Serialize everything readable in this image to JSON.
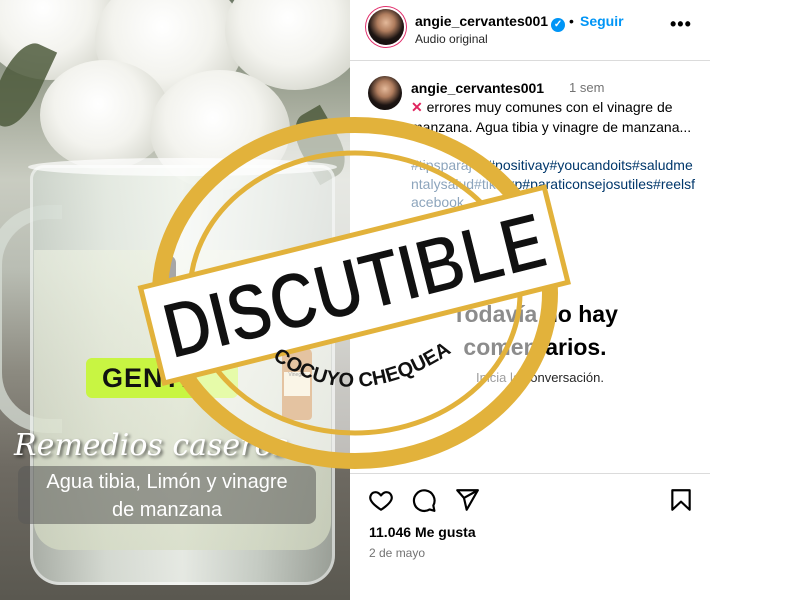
{
  "post": {
    "username": "angie_cervantes001",
    "verified_mark": "✓",
    "follow_label": "Seguir",
    "separator": "•",
    "audio_label": "Audio original",
    "more_label": "•••",
    "caption_time": "1 sem",
    "caption_mark": "✕",
    "caption_text": "errores muy comunes con el vinagre de manzana. Agua tibia y vinagre de manzana...",
    "hashtags": "#tipsparajep#positivay#youcandoits#saludmentalysalud#tiktokp#paraticonsejosutiles#reelsfacebook",
    "no_comments": "Todavía no hay comentarios.",
    "start_conversation": "Inicia la conversación.",
    "likes": "11.046 Me gusta",
    "date": "2 de mayo"
  },
  "media": {
    "tag": "GENTE",
    "title": "Remedios caseros",
    "ingredients_line1": "Agua tibia, Limón y vinagre",
    "ingredients_line2": "de manzana",
    "vinegar_label": "Vinegar"
  },
  "stamp": {
    "verdict": "DISCUTIBLE",
    "brand": "COCUYO CHEQUEA"
  },
  "icons": {
    "like": "heart-icon",
    "comment": "comment-icon",
    "share": "share-icon",
    "save": "bookmark-icon"
  },
  "colors": {
    "accent": "#0095f6",
    "tag_green": "#c8f542",
    "stamp_gold": "#e2b23b",
    "stamp_text": "#111111",
    "hashtag": "#00376b"
  }
}
